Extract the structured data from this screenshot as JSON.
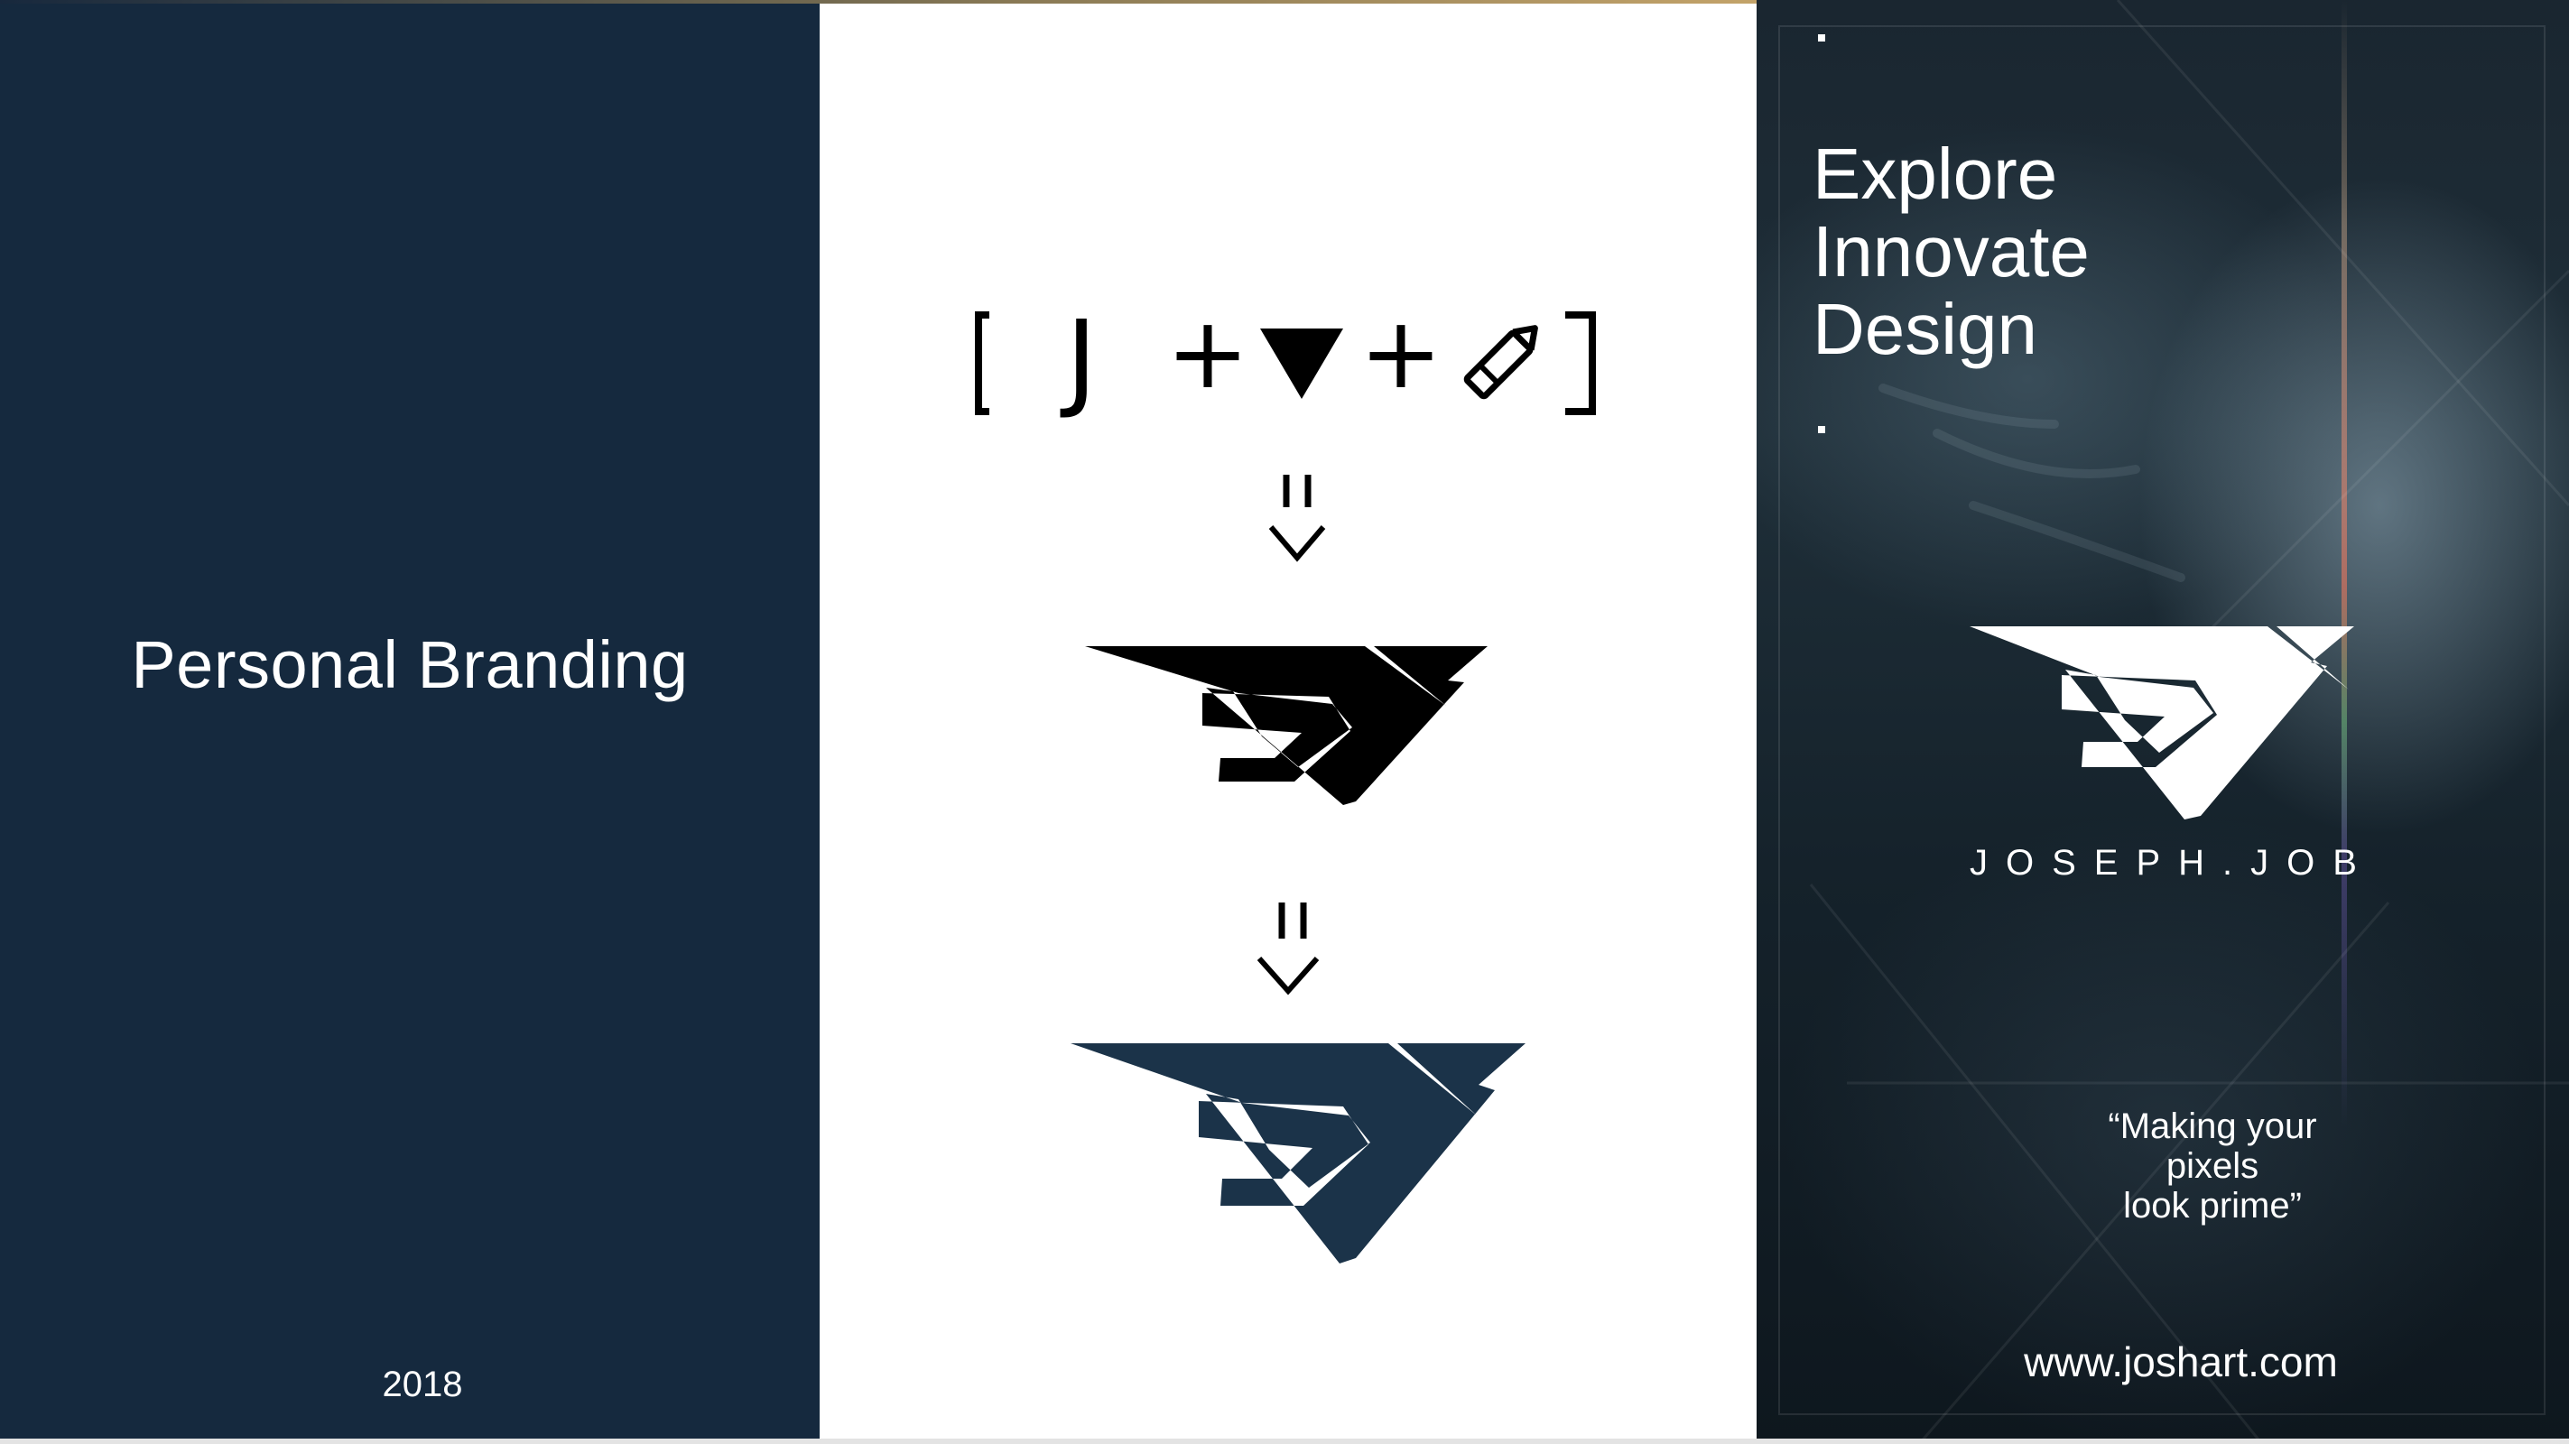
{
  "left_panel": {
    "title": "Personal Branding",
    "year": "2018"
  },
  "middle_panel": {
    "equation_letter": "J",
    "plus_symbol": "+",
    "icons": [
      "bracket-open-icon",
      "triangle-icon",
      "pencil-icon",
      "bracket-close-icon",
      "double-arrow-down-icon",
      "jj-logo-black",
      "jj-logo-navy"
    ]
  },
  "right_panel": {
    "tagline": [
      "Explore",
      "Innovate",
      "Design"
    ],
    "brand_name": "JOSEPH.JOB",
    "quote": [
      "“Making your",
      "pixels",
      "look prime”"
    ],
    "url": "www.joshart.com"
  },
  "colors": {
    "navy": "#15293e",
    "logo_navy": "#1b3349",
    "black": "#000000",
    "white": "#ffffff"
  }
}
